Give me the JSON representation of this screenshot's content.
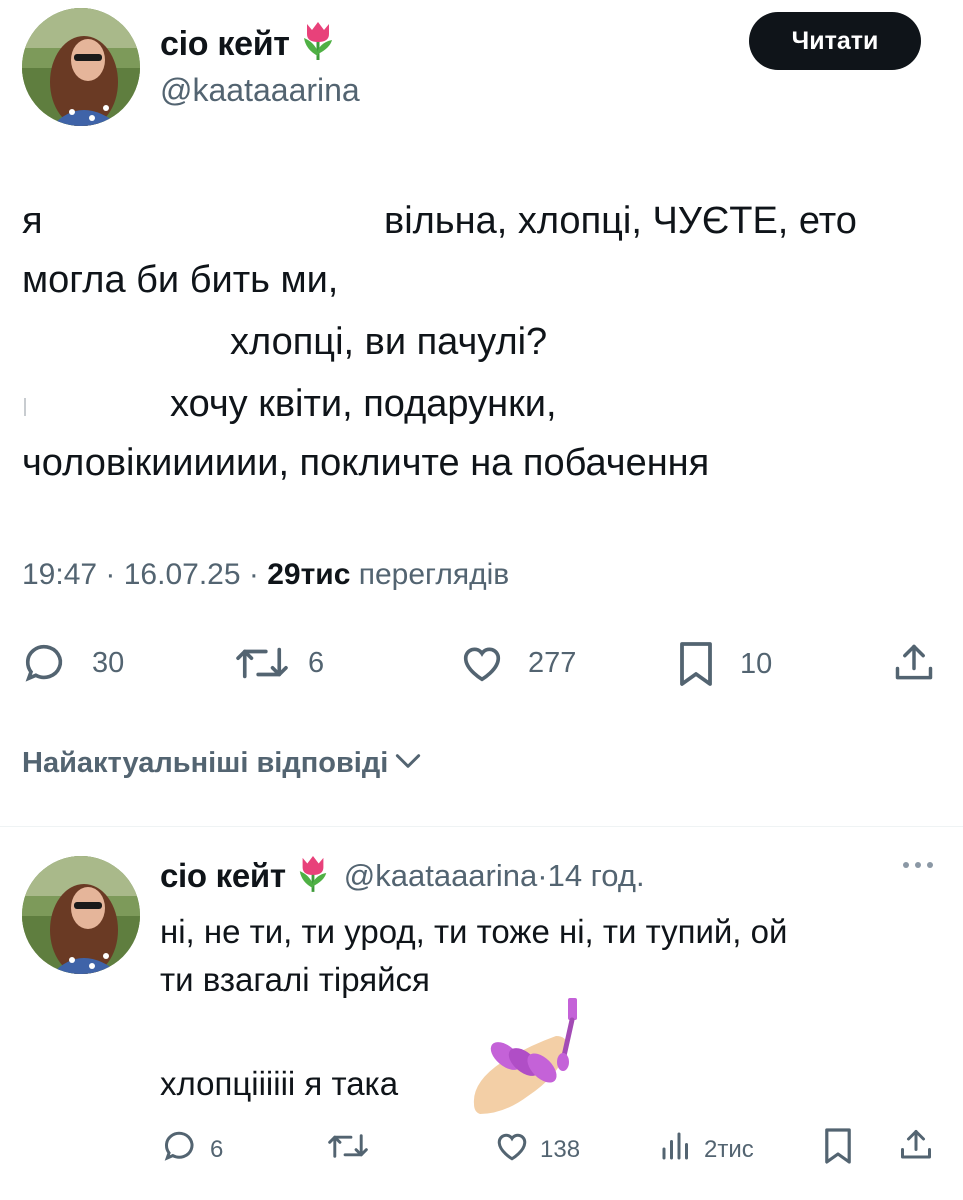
{
  "main_tweet": {
    "author_name": "сіо кейт",
    "author_emoji": "tulip-emoji",
    "handle": "@kaataaarina",
    "follow_label": "Читати",
    "lines": [
      "я",
      "вільна, хлопці, ЧУЄТЕ, ето",
      "могла би бить ми,",
      "хлопці, ви пачулі?",
      "хочу квіти, подарунки,",
      "чоловікииииии, покличте на побачення"
    ],
    "time": "19:47",
    "date": "16.07.25",
    "views_count": "29тис",
    "views_label": "переглядів",
    "actions": {
      "replies": "30",
      "reposts": "6",
      "likes": "277",
      "bookmarks": "10"
    }
  },
  "replies_sort": {
    "label": "Найактуальніші відповіді"
  },
  "reply": {
    "author_name": "сіо кейт",
    "author_emoji": "tulip-emoji",
    "handle": "@kaataaarina",
    "time_ago": "14 год.",
    "text_lines": [
      "ні, не ти, ти урод, ти тоже ні, ти тупий, ой",
      "ти взагалі тіряйся",
      "хлопціііііі я така"
    ],
    "trailing_emoji": "nail-polish-emoji",
    "actions": {
      "replies": "6",
      "reposts": "",
      "likes": "138",
      "views": "2тис"
    }
  },
  "colors": {
    "text": "#0f1419",
    "secondary": "#536471",
    "button_bg": "#0f1419",
    "divider": "#eff3f4",
    "tulip": "#e8417a",
    "nail": "#c462d8"
  }
}
